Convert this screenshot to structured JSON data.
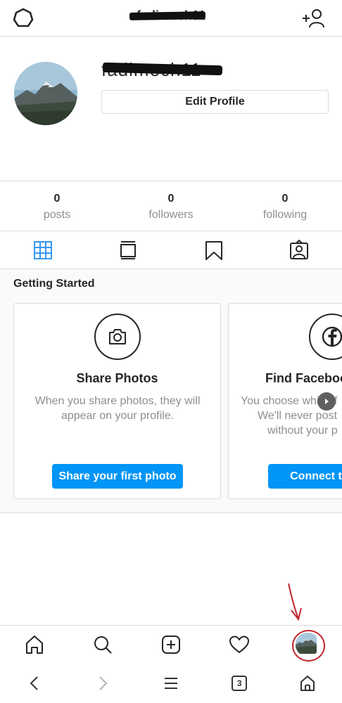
{
  "header": {
    "username": "fadimech11"
  },
  "profile": {
    "username": "fadimech11",
    "edit_label": "Edit Profile"
  },
  "stats": [
    {
      "value": "0",
      "label": "posts"
    },
    {
      "value": "0",
      "label": "followers"
    },
    {
      "value": "0",
      "label": "following"
    }
  ],
  "getting_started": {
    "title": "Getting Started",
    "cards": [
      {
        "icon": "camera-icon",
        "title": "Share Photos",
        "description": "When you share photos, they will appear on your profile.",
        "button": "Share your first photo"
      },
      {
        "icon": "facebook-icon",
        "title": "Find Faceboo",
        "description_lines": [
          "You choose which f",
          "We'll never post",
          "without your p"
        ],
        "button": "Connect to F"
      }
    ]
  },
  "browser": {
    "tab_count": "3"
  },
  "colors": {
    "accent": "#0095f6",
    "text": "#262626",
    "muted": "#8e8e8e",
    "border": "#dbdbdb",
    "annotation": "#c1272d",
    "grid_tab_active": "#3897f0"
  }
}
